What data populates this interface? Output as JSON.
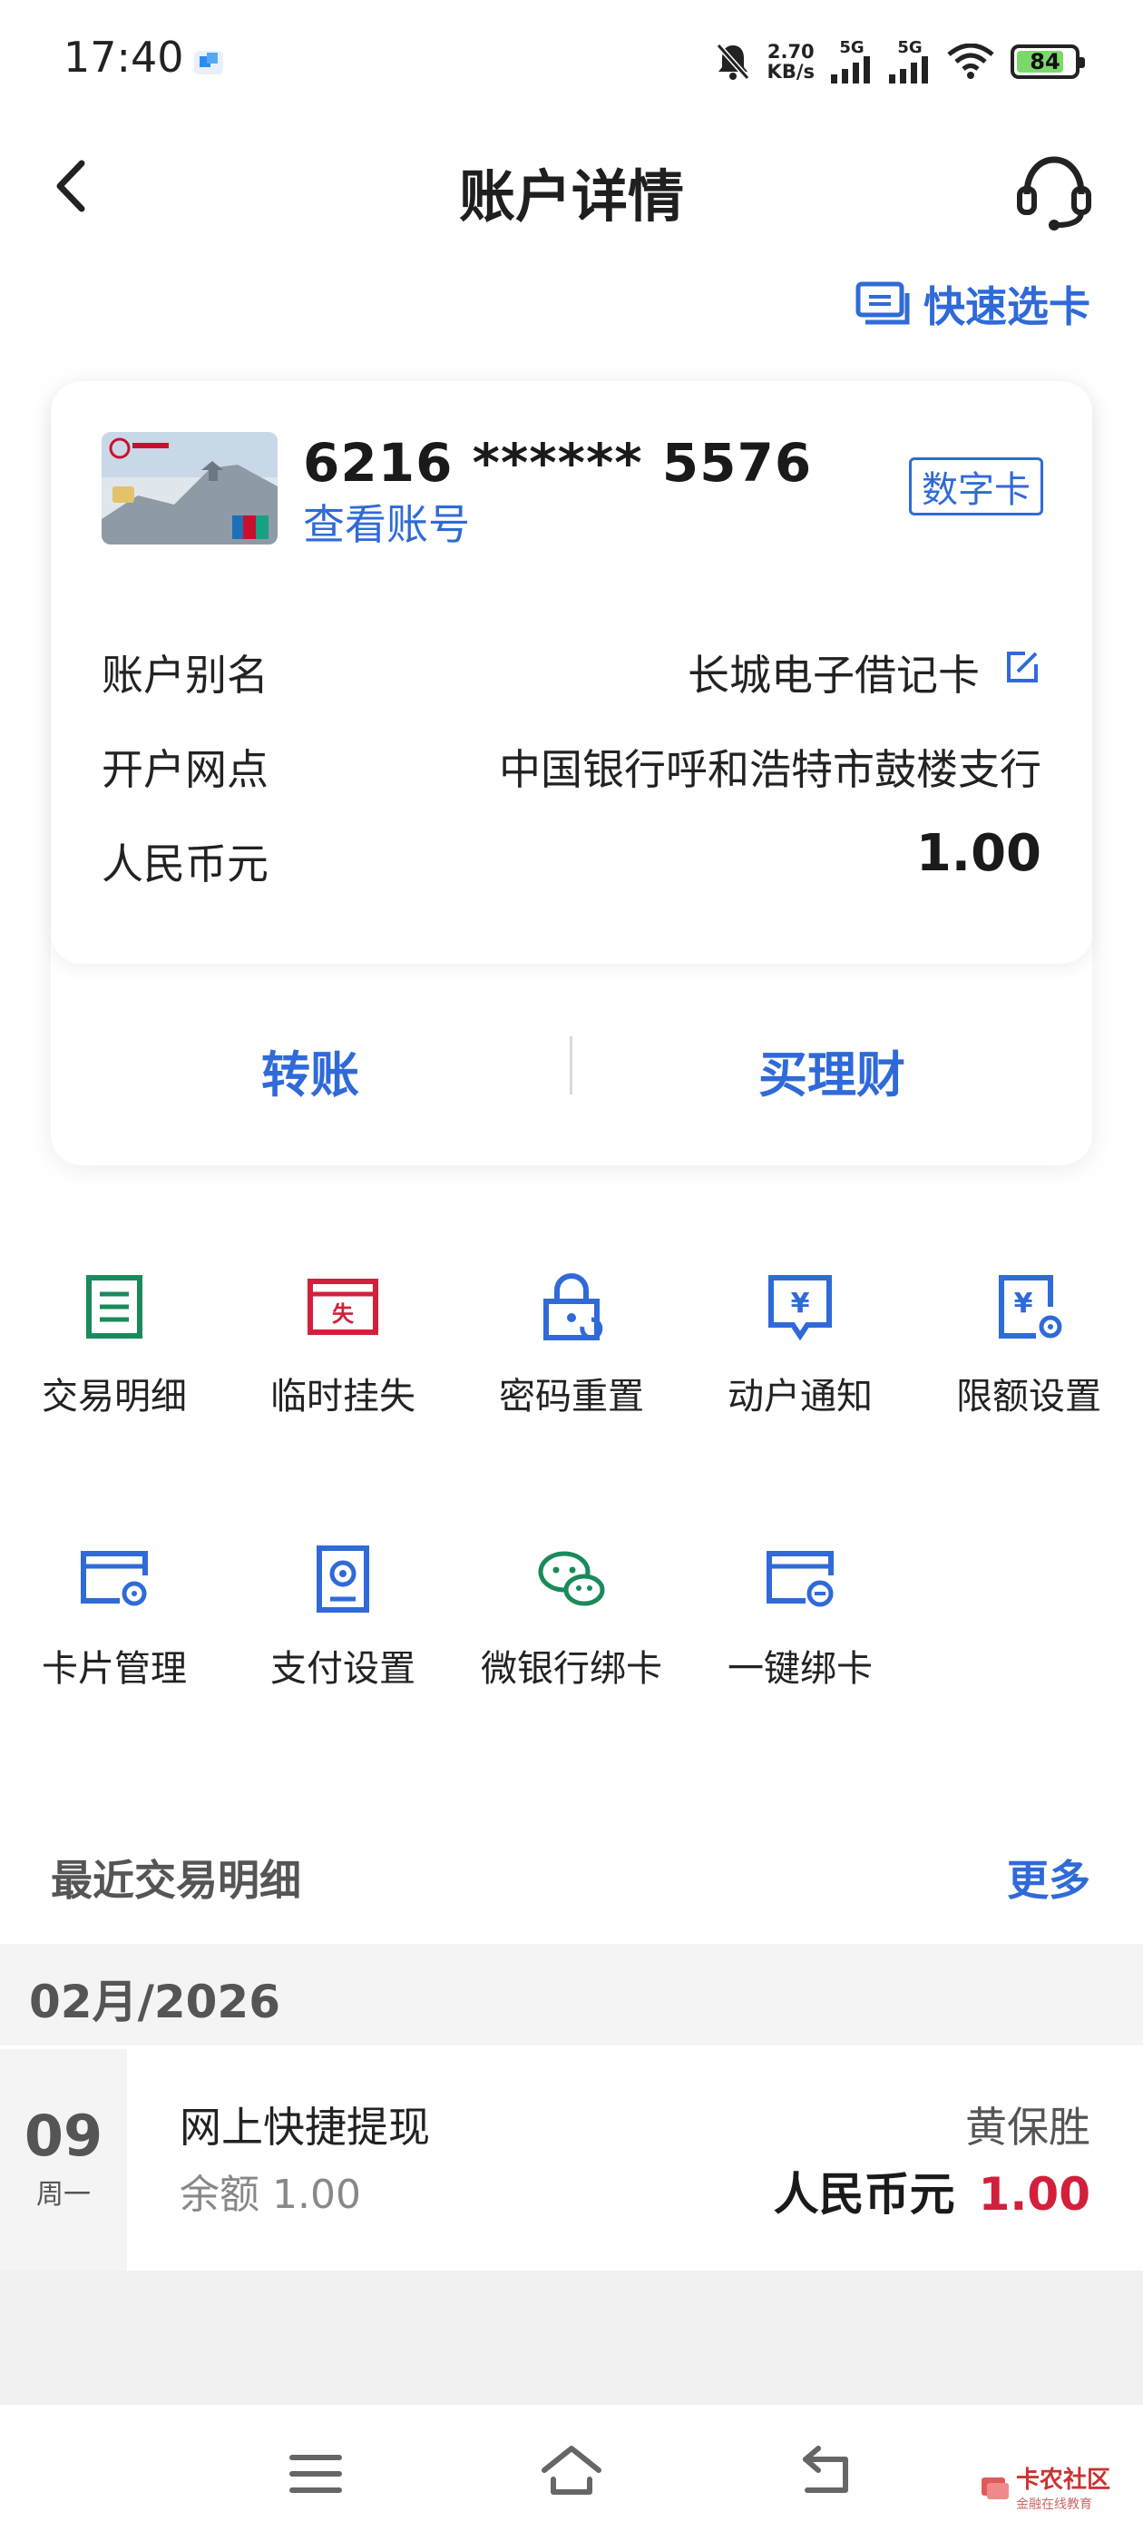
{
  "status_bar": {
    "time": "17:40",
    "net_speed_value": "2.70",
    "net_speed_unit": "KB/s",
    "signal_1": "5G",
    "signal_2": "5G",
    "battery": "84",
    "battery_level_percent": 84
  },
  "nav": {
    "title": "账户详情"
  },
  "quick_select_label": "快速选卡",
  "card": {
    "number": "6216 ****** 5576",
    "view_account_label": "查看账号",
    "badge": "数字卡",
    "rows": [
      {
        "label": "账户别名",
        "value": "长城电子借记卡"
      },
      {
        "label": "开户网点",
        "value": "中国银行呼和浩特市鼓楼支行"
      },
      {
        "label": "人民币元",
        "value": "1.00"
      }
    ],
    "actions": [
      {
        "label": "转账"
      },
      {
        "label": "买理财"
      }
    ]
  },
  "functions": [
    {
      "label": "交易明细",
      "icon": "ledger-icon"
    },
    {
      "label": "临时挂失",
      "icon": "loss-report-icon"
    },
    {
      "label": "密码重置",
      "icon": "lock-reset-icon"
    },
    {
      "label": "动户通知",
      "icon": "yuan-message-icon"
    },
    {
      "label": "限额设置",
      "icon": "yuan-settings-icon"
    },
    {
      "label": "卡片管理",
      "icon": "card-settings-icon"
    },
    {
      "label": "支付设置",
      "icon": "payment-settings-icon"
    },
    {
      "label": "微银行绑卡",
      "icon": "wechat-bind-icon"
    },
    {
      "label": "一键绑卡",
      "icon": "card-link-icon"
    }
  ],
  "recent": {
    "title": "最近交易明细",
    "more_label": "更多",
    "month": "02月/2026",
    "transactions": [
      {
        "day": "09",
        "weekday": "周一",
        "name": "网上快捷提现",
        "balance": "余额 1.00",
        "payee": "黄保胜",
        "currency": "人民币元",
        "amount": "1.00"
      }
    ]
  },
  "watermark": {
    "text": "卡农社区",
    "sub": "金融在线教育"
  },
  "colors": {
    "accent": "#2f6ad8",
    "green_icon": "#1a8a5a",
    "red_icon": "#d2203c",
    "amount_red": "#d2203c"
  }
}
